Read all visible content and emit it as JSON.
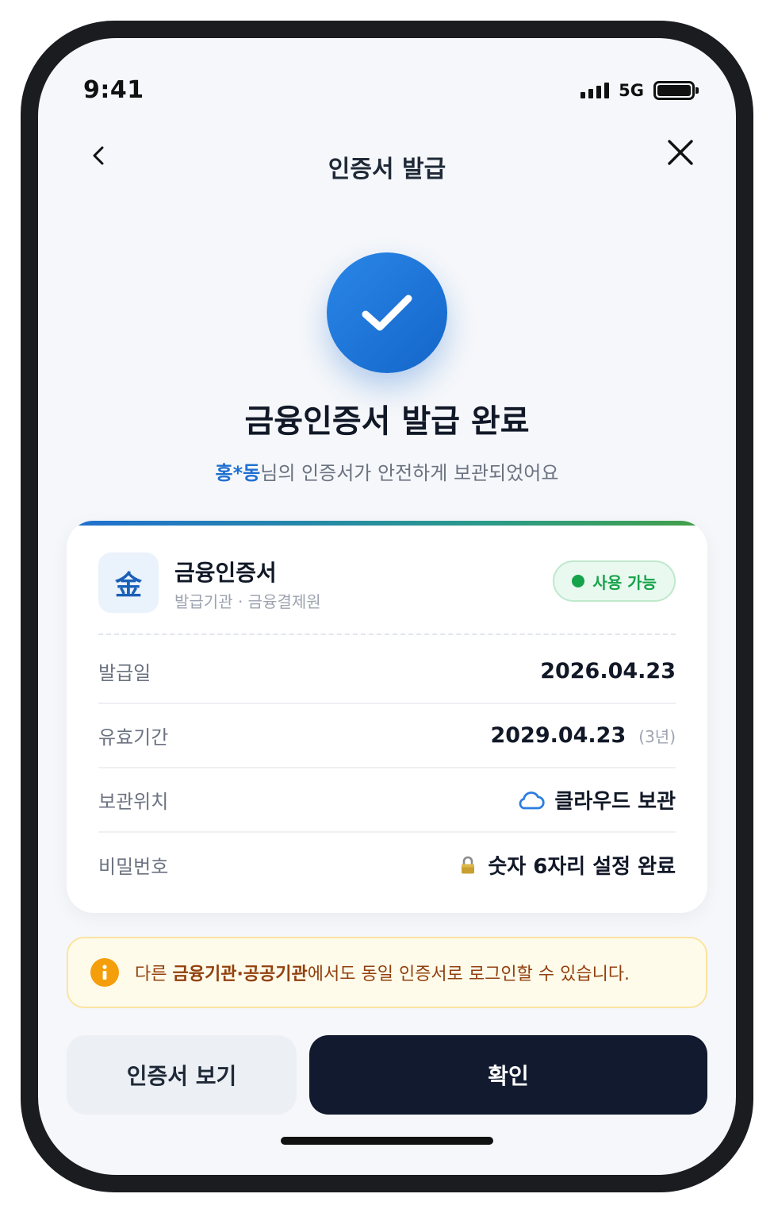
{
  "status_bar": {
    "time": "9:41",
    "network": "5G"
  },
  "nav": {
    "title": "인증서 발급",
    "back_icon": "chevron-left-icon",
    "close_icon": "close-icon"
  },
  "success": {
    "icon": "check-icon",
    "title": "금융인증서 발급 완료",
    "name": "홍*동",
    "message_rest": "님의 인증서가 안전하게 보관되었어요"
  },
  "card": {
    "accent_gradient": [
      "#1f6fd1",
      "#43a047"
    ],
    "logo_char": "金",
    "name": "금융인증서",
    "issuer": "발급기관 · 금융결제원",
    "status": "사용 가능",
    "rows": [
      {
        "label": "발급일",
        "value": "2026.04.23"
      },
      {
        "label": "유효기간",
        "value": "2029.04.23",
        "sub": "(3년)"
      },
      {
        "label": "보관위치",
        "value": "클라우드 보관",
        "icon": "cloud-icon"
      },
      {
        "label": "비밀번호",
        "value": "숫자 6자리 설정 완료",
        "icon": "lock-icon"
      }
    ]
  },
  "info": {
    "icon": "info-icon",
    "prefix": "다른 ",
    "highlight": "금융기관·공공기관",
    "suffix": "에서도 동일 인증서로 로그인할 수 있습니다."
  },
  "buttons": {
    "secondary": "인증서 보기",
    "primary": "확인"
  },
  "colors": {
    "brand_blue": "#1f6fd1",
    "success_green": "#16a34a",
    "primary_button": "#111a2e",
    "info_bg": "#fffbea"
  }
}
